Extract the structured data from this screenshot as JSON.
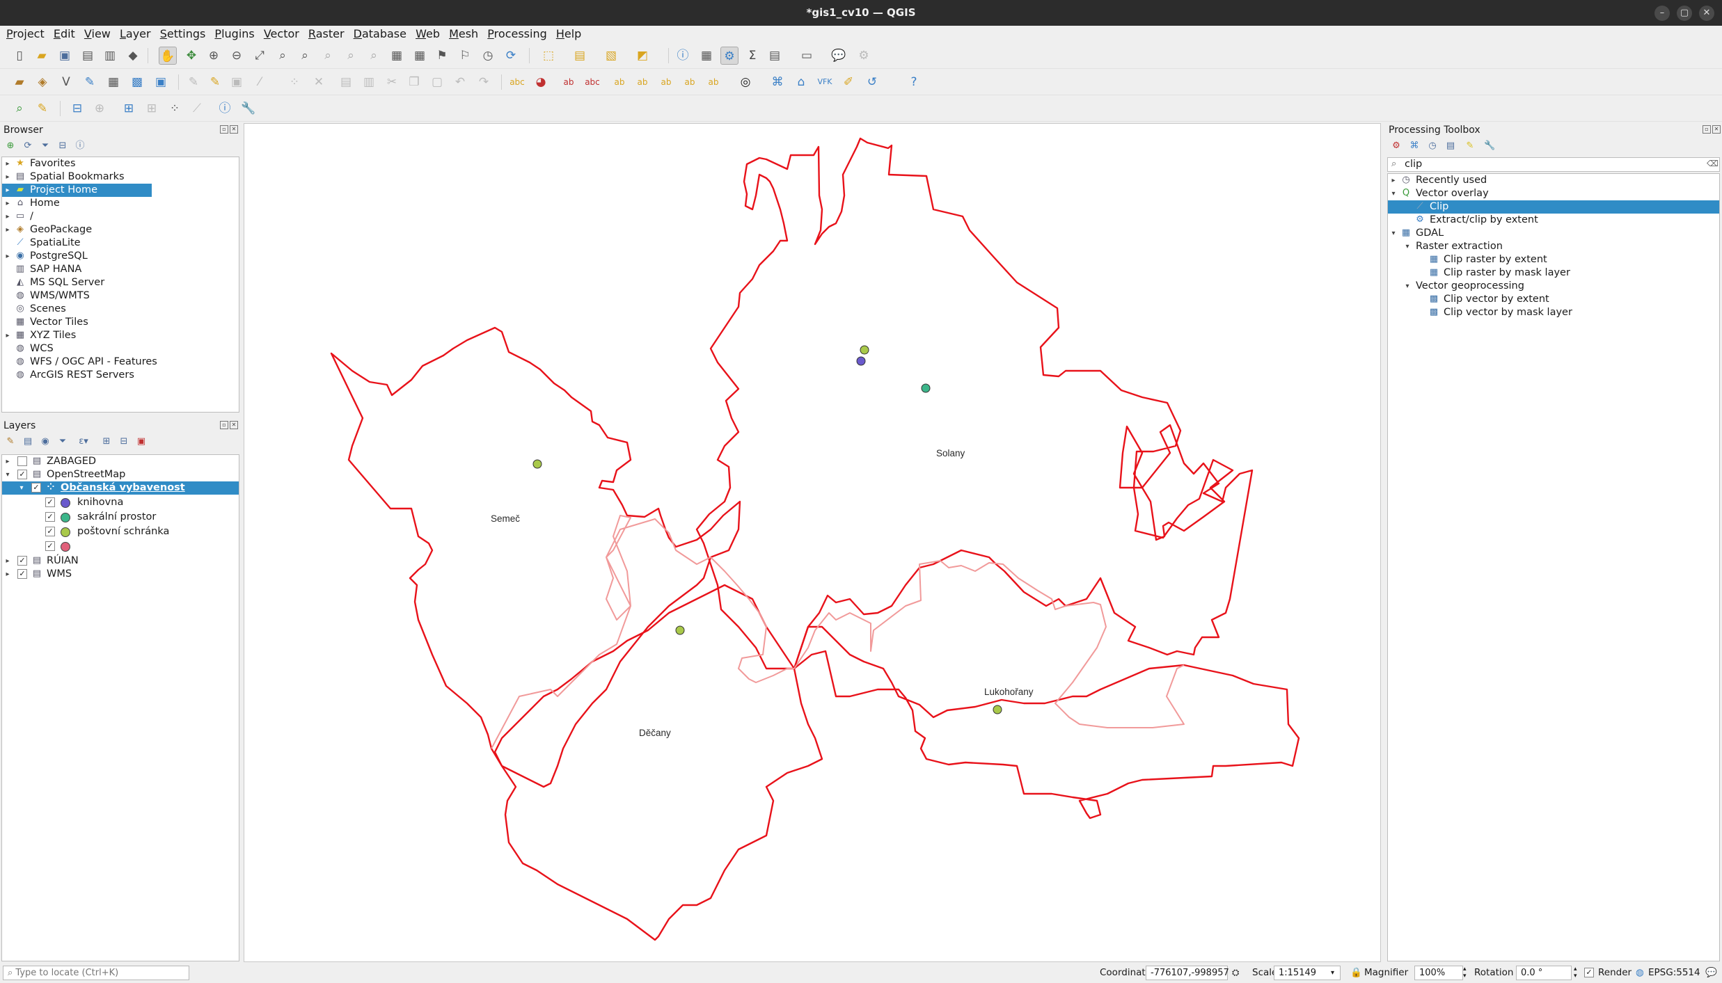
{
  "window": {
    "title": "*gis1_cv10 — QGIS",
    "minimize": "–",
    "maximize": "▢",
    "close": "✕"
  },
  "menu": [
    "Project",
    "Edit",
    "View",
    "Layer",
    "Settings",
    "Plugins",
    "Vector",
    "Raster",
    "Database",
    "Web",
    "Mesh",
    "Processing",
    "Help"
  ],
  "browser": {
    "title": "Browser",
    "items": [
      {
        "label": "Favorites",
        "icon": "star-icon"
      },
      {
        "label": "Spatial Bookmarks",
        "icon": "bookmark-icon"
      },
      {
        "label": "Project Home",
        "icon": "project-home-icon"
      },
      {
        "label": "Home",
        "icon": "home-folder-icon"
      },
      {
        "label": "/",
        "icon": "folder-icon"
      },
      {
        "label": "GeoPackage",
        "icon": "geopackage-icon"
      },
      {
        "label": "SpatiaLite",
        "icon": "spatialite-icon"
      },
      {
        "label": "PostgreSQL",
        "icon": "postgresql-icon"
      },
      {
        "label": "SAP HANA",
        "icon": "sap-hana-icon"
      },
      {
        "label": "MS SQL Server",
        "icon": "mssql-icon"
      },
      {
        "label": "WMS/WMTS",
        "icon": "wms-icon"
      },
      {
        "label": "Scenes",
        "icon": "scenes-icon"
      },
      {
        "label": "Vector Tiles",
        "icon": "vector-tiles-icon"
      },
      {
        "label": "XYZ Tiles",
        "icon": "xyz-tiles-icon"
      },
      {
        "label": "WCS",
        "icon": "wcs-icon"
      },
      {
        "label": "WFS / OGC API - Features",
        "icon": "wfs-icon"
      },
      {
        "label": "ArcGIS REST Servers",
        "icon": "arcgis-icon"
      }
    ]
  },
  "layers": {
    "title": "Layers",
    "items": [
      {
        "label": "ZABAGED",
        "checked": false
      },
      {
        "label": "OpenStreetMap",
        "checked": true
      },
      {
        "label": "Občanská vybavenost",
        "checked": true
      },
      {
        "label": "knihovna",
        "checked": true,
        "color": "#6a5acd"
      },
      {
        "label": "sakrální prostor",
        "checked": true,
        "color": "#3cb68a"
      },
      {
        "label": "poštovní schránka",
        "checked": true,
        "color": "#a9c94a"
      },
      {
        "label": "",
        "checked": true,
        "color": "#e0607a"
      },
      {
        "label": "RÚIAN",
        "checked": true
      },
      {
        "label": "WMS",
        "checked": true
      }
    ]
  },
  "map": {
    "labels": [
      "Solany",
      "Semeč",
      "Děčany",
      "Lukohořany"
    ],
    "colors": {
      "boundary": "#e8121a",
      "boundary_light": "#f19a9a",
      "knihovna": "#6a5acd",
      "sakralni": "#3cb68a",
      "postovni": "#a9c94a"
    }
  },
  "toolbox": {
    "title": "Processing Toolbox",
    "search": "clip",
    "items": [
      {
        "label": "Recently used",
        "icon": "clock-icon"
      },
      {
        "label": "Vector overlay",
        "icon": "qgis-icon"
      },
      {
        "label": "Clip",
        "icon": "clip-tool-icon"
      },
      {
        "label": "Extract/clip by extent",
        "icon": "gear-icon"
      },
      {
        "label": "GDAL",
        "icon": "gdal-icon"
      },
      {
        "label": "Raster extraction",
        "icon": ""
      },
      {
        "label": "Clip raster by extent",
        "icon": "raster-icon"
      },
      {
        "label": "Clip raster by mask layer",
        "icon": "raster-icon"
      },
      {
        "label": "Vector geoprocessing",
        "icon": ""
      },
      {
        "label": "Clip vector by extent",
        "icon": "vector-icon"
      },
      {
        "label": "Clip vector by mask layer",
        "icon": "vector-icon"
      }
    ]
  },
  "status": {
    "locate_placeholder": "Type to locate (Ctrl+K)",
    "coordinate_label": "Coordinate",
    "coordinate": "-776107,-998957",
    "scale_label": "Scale",
    "scale": "1:15149",
    "magnifier_label": "Magnifier",
    "magnifier": "100%",
    "rotation_label": "Rotation",
    "rotation": "0.0 °",
    "render_label": "Render",
    "crs": "EPSG:5514"
  }
}
